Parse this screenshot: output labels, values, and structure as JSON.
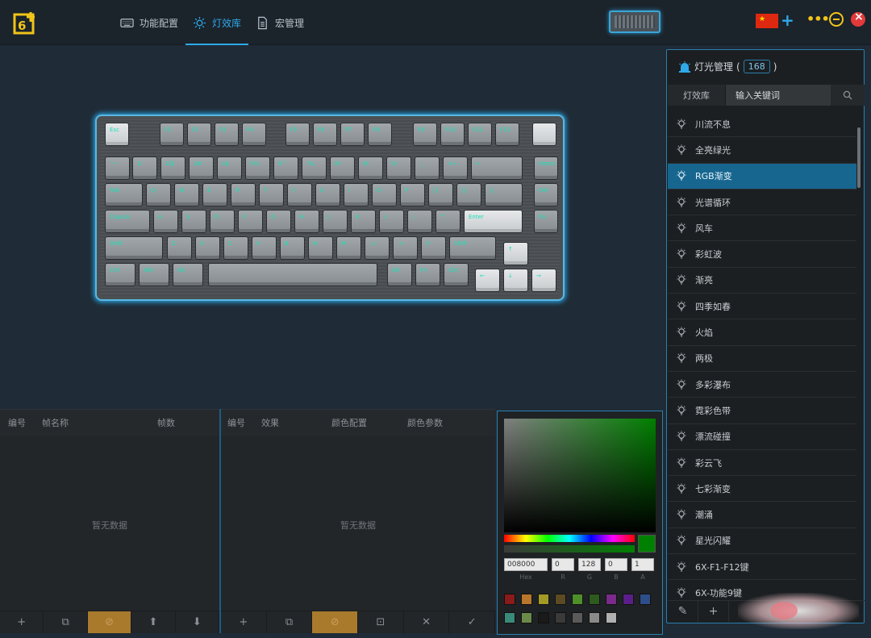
{
  "app": {
    "nav": [
      {
        "label": "功能配置",
        "icon": "keyboard-icon"
      },
      {
        "label": "灯效库",
        "icon": "light-icon"
      },
      {
        "label": "宏管理",
        "icon": "document-icon"
      }
    ],
    "active_nav": 1,
    "flag_icon": "china-flag-icon",
    "colors": {
      "accent": "#2fa9e8",
      "selected": "#17668f",
      "key_glow": "#19e0b5",
      "orange": "#a97a2c"
    }
  },
  "frames_panel": {
    "headers": [
      "编号",
      "帧名称",
      "帧数"
    ],
    "empty_text": "暂无数据",
    "footer_icons": [
      "plus-icon",
      "copy-icon",
      "delete-icon",
      "arrow-up-icon",
      "arrow-down-icon"
    ]
  },
  "effects_panel": {
    "headers": [
      "编号",
      "效果",
      "颜色配置",
      "颜色参数"
    ],
    "empty_text": "暂无数据",
    "footer_icons": [
      "plus-icon",
      "copy-icon",
      "delete-icon",
      "import-icon",
      "close-icon",
      "check-icon"
    ]
  },
  "color_picker": {
    "hex": "008000",
    "r": "0",
    "g": "128",
    "b": "0",
    "a": "1",
    "labels": {
      "hex": "Hex",
      "r": "R",
      "g": "G",
      "b": "B",
      "a": "A"
    },
    "swatches": [
      "#8b1a1a",
      "#b8762a",
      "#a39a26",
      "#5c4a22",
      "#4e8f2a",
      "#2e5a1f",
      "#7a2a8a",
      "#5a1e8a",
      "#2e4e8a",
      "#3a8a7a",
      "#6a8a4a",
      "#1a1a1a",
      "#3a3a3a",
      "#5a5a5a",
      "#8a8a8a",
      "#b0b0b0"
    ]
  },
  "sidebar": {
    "title": "灯光管理",
    "paren_open": "(",
    "count": "168",
    "paren_close": ")",
    "tab": "灯效库",
    "search_placeholder": "输入关键词",
    "selected_index": 2,
    "items": [
      "川流不息",
      "全亮绿光",
      "RGB渐变",
      "光谱循环",
      "风车",
      "彩虹波",
      "渐亮",
      "四季如春",
      "火焰",
      "两极",
      "多彩瀑布",
      "霓彩色带",
      "漂流碰撞",
      "彩云飞",
      "七彩渐变",
      "潮涌",
      "星光闪耀",
      "6X-F1-F12键",
      "6X-功能9键"
    ]
  },
  "keyboard": {
    "rows": [
      [
        "Esc",
        "F1",
        "F2",
        "F3",
        "F4",
        "F5",
        "F6",
        "F7",
        "F8",
        "F9",
        "F10",
        "F11",
        "F12"
      ],
      [
        "`~",
        "1!",
        "2@",
        "3#",
        "4$",
        "5%",
        "6^",
        "7&",
        "8*",
        "9(",
        "0)",
        "-_",
        "=+",
        "←",
        "Home"
      ],
      [
        "Tab",
        "Q",
        "W",
        "E",
        "R",
        "T",
        "Y",
        "U",
        "I",
        "O",
        "P",
        "[{",
        "]}",
        "\\|",
        "Del"
      ],
      [
        "CapsLk",
        "A",
        "S",
        "D",
        "F",
        "G",
        "H",
        "J",
        "K",
        "L",
        ";:",
        "'\"",
        "Enter",
        "Pu"
      ],
      [
        "Shift",
        "Z",
        "X",
        "C",
        "V",
        "B",
        "N",
        "M",
        ",<",
        ".>",
        "/?",
        "Shift",
        "↑"
      ],
      [
        "Ctrl",
        "Win",
        "Alt",
        "",
        "Alt",
        "Fn",
        "Ctrl",
        "←",
        "↓",
        "→"
      ]
    ]
  }
}
